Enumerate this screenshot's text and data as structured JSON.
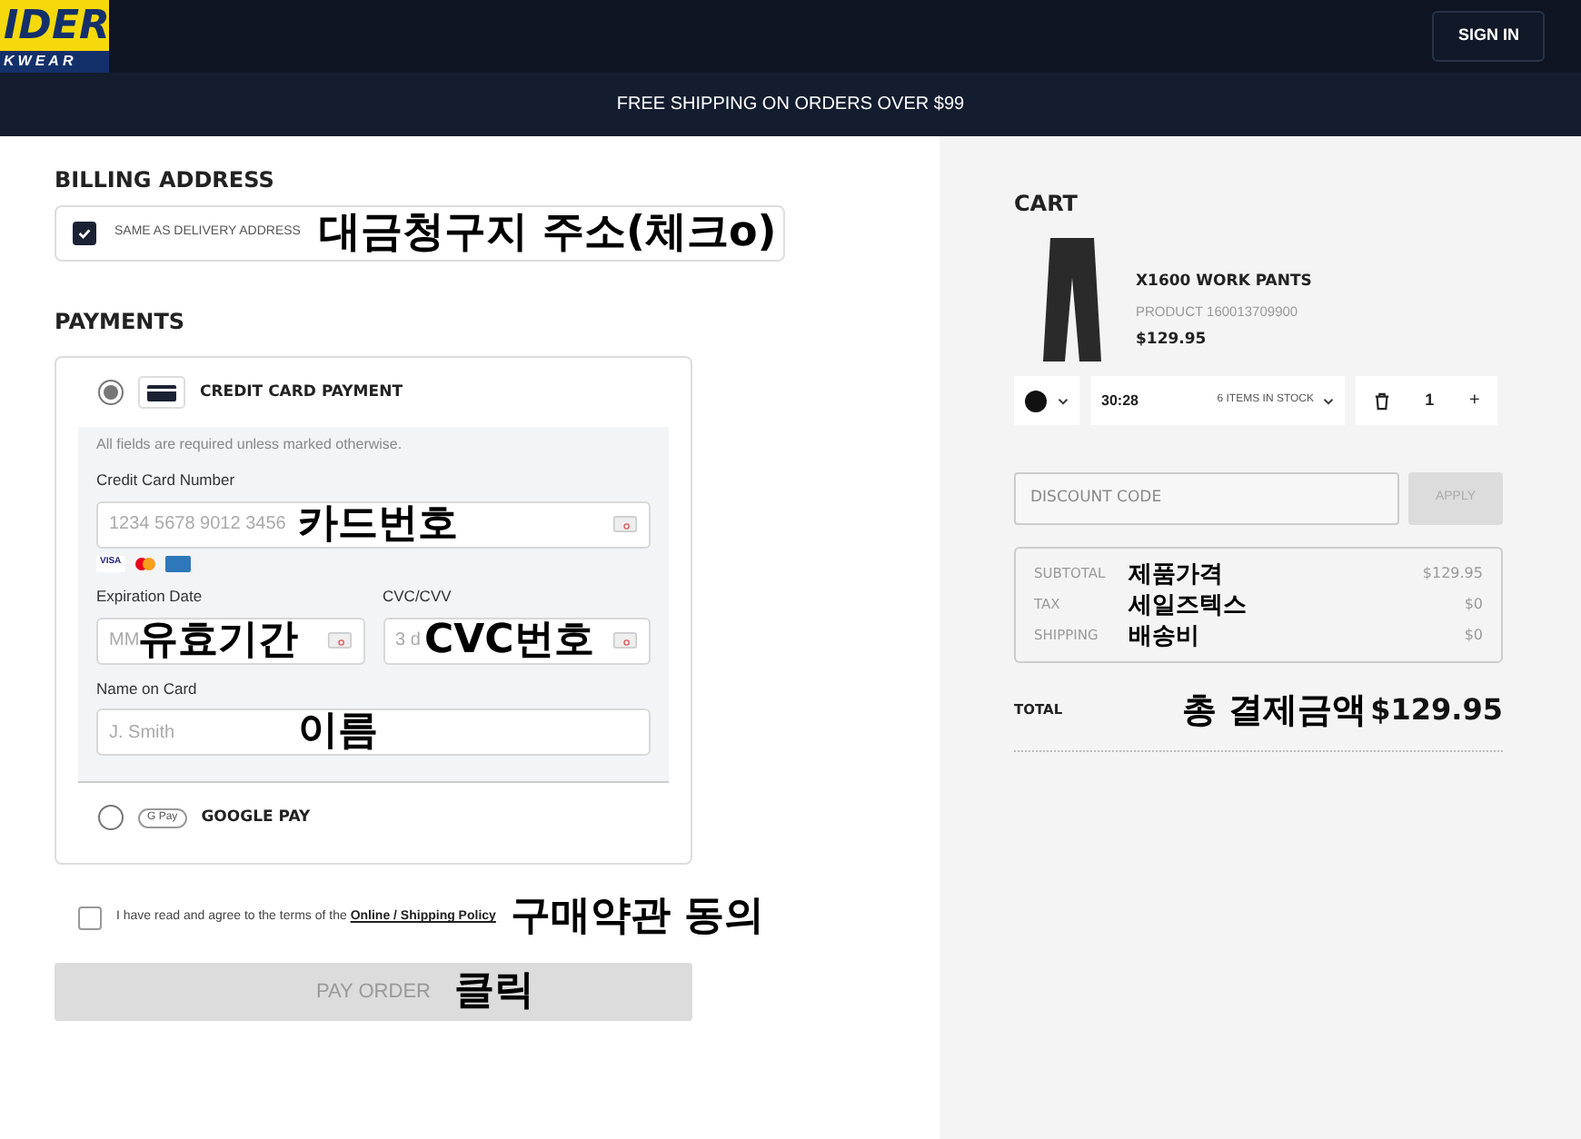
{
  "header": {
    "logo": {
      "line_1": "IDER",
      "line_2": "KWEAR"
    },
    "sign_in": "SIGN IN"
  },
  "banner": "FREE SHIPPING ON ORDERS OVER $99",
  "billing": {
    "title": "BILLING ADDRESS",
    "same_as_delivery": {
      "label": "SAME AS DELIVERY ADDRESS",
      "checked": true
    },
    "annotation": "대금청구지 주소(체크o)"
  },
  "payments": {
    "title": "PAYMENTS",
    "methods": [
      {
        "kind": "card",
        "label": "CREDIT CARD PAYMENT",
        "selected": true
      },
      {
        "kind": "gpay",
        "label": "GOOGLE PAY",
        "badge": "G Pay",
        "selected": false
      }
    ],
    "form": {
      "note": "All fields are required unless marked otherwise.",
      "brand_label": "VISA",
      "card_number": {
        "label": "Credit Card Number",
        "placeholder": "1234 5678 9012 3456",
        "annotation": "카드번호"
      },
      "expiration": {
        "label": "Expiration Date",
        "placeholder": "MM",
        "annotation": "유효기간"
      },
      "cvc": {
        "label": "CVC/CVV",
        "placeholder": "3 d",
        "annotation": "CVC번호"
      },
      "name": {
        "label": "Name on Card",
        "placeholder": "J. Smith",
        "annotation": "이름"
      }
    }
  },
  "terms": {
    "checked": false,
    "text": "I have read and agree to the terms of the",
    "link": "Online / Shipping Policy",
    "annotation": "구매약관 동의"
  },
  "pay_button": {
    "label": "PAY ORDER",
    "disabled": true,
    "annotation": "클릭"
  },
  "cart": {
    "title": "CART",
    "item": {
      "name": "X1600 WORK PANTS",
      "product": "PRODUCT 160013709900",
      "price": "$129.95",
      "color": "#111111",
      "size": "30:28",
      "stock": "6 ITEMS IN STOCK",
      "quantity": "1",
      "plus": "+"
    },
    "discount": {
      "placeholder": "DISCOUNT CODE",
      "apply": "APPLY"
    },
    "summary": [
      {
        "label": "SUBTOTAL",
        "annotation": "제품가격",
        "value": "$129.95"
      },
      {
        "label": "TAX",
        "annotation": "세일즈텍스",
        "value": "$0"
      },
      {
        "label": "SHIPPING",
        "annotation": "배송비",
        "value": "$0"
      }
    ],
    "total": {
      "label": "TOTAL",
      "annotation": "총 결제금액",
      "value": "$129.95"
    }
  }
}
